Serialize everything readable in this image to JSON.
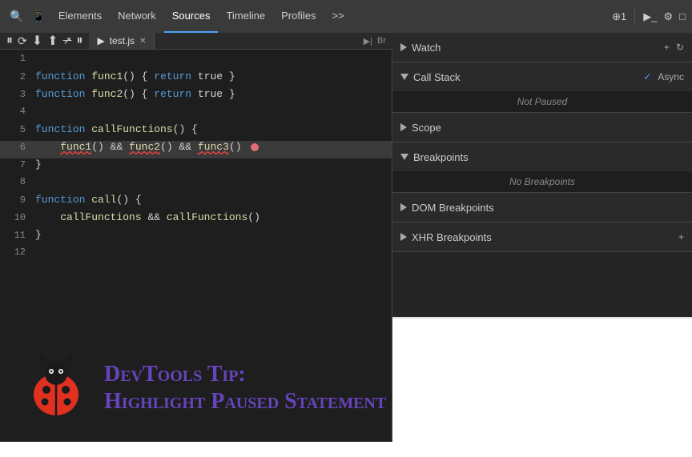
{
  "toolbar": {
    "nav_items": [
      "Elements",
      "Network",
      "Sources",
      "Timeline",
      "Profiles"
    ],
    "active_nav": "Sources",
    "right_icons": [
      "⊕1",
      "▶",
      "⚙",
      "□"
    ],
    "more_label": ">>"
  },
  "tabbar": {
    "debug_controls": [
      "⏸",
      "⟳",
      "⬇",
      "⬆",
      "↗",
      "⏸"
    ],
    "file_tab": "test.js",
    "tab_icons": [
      "▶|",
      "Br"
    ]
  },
  "code": {
    "lines": [
      {
        "num": 1,
        "text": ""
      },
      {
        "num": 2,
        "text": "function func1() { return true }"
      },
      {
        "num": 3,
        "text": "function func2() { return true }"
      },
      {
        "num": 4,
        "text": ""
      },
      {
        "num": 5,
        "text": "function callFunctions() {"
      },
      {
        "num": 6,
        "text": "    func1() && func2() && func3()",
        "highlight": true,
        "error": true,
        "breakpoint": true
      },
      {
        "num": 7,
        "text": "}"
      },
      {
        "num": 8,
        "text": ""
      },
      {
        "num": 9,
        "text": "function call() {"
      },
      {
        "num": 10,
        "text": "    callFunctions && callFunctions()"
      },
      {
        "num": 11,
        "text": "}"
      },
      {
        "num": 12,
        "text": ""
      }
    ]
  },
  "right_panel": {
    "sections": [
      {
        "id": "watch",
        "label": "Watch",
        "expanded": false,
        "triangle": "right",
        "actions": [
          "+",
          "↻"
        ]
      },
      {
        "id": "call-stack",
        "label": "Call Stack",
        "expanded": true,
        "triangle": "down",
        "async": true,
        "async_label": "Async",
        "content": "Not Paused"
      },
      {
        "id": "scope",
        "label": "Scope",
        "expanded": false,
        "triangle": "right"
      },
      {
        "id": "breakpoints",
        "label": "Breakpoints",
        "expanded": true,
        "triangle": "down",
        "content": "No Breakpoints"
      },
      {
        "id": "dom-breakpoints",
        "label": "DOM Breakpoints",
        "expanded": false,
        "triangle": "right"
      },
      {
        "id": "xhr-breakpoints",
        "label": "XHR Breakpoints",
        "expanded": false,
        "triangle": "right",
        "actions": [
          "+"
        ]
      }
    ]
  },
  "tip": {
    "title": "DevTools Tip:",
    "subtitle": "Highlight Paused Statement"
  }
}
